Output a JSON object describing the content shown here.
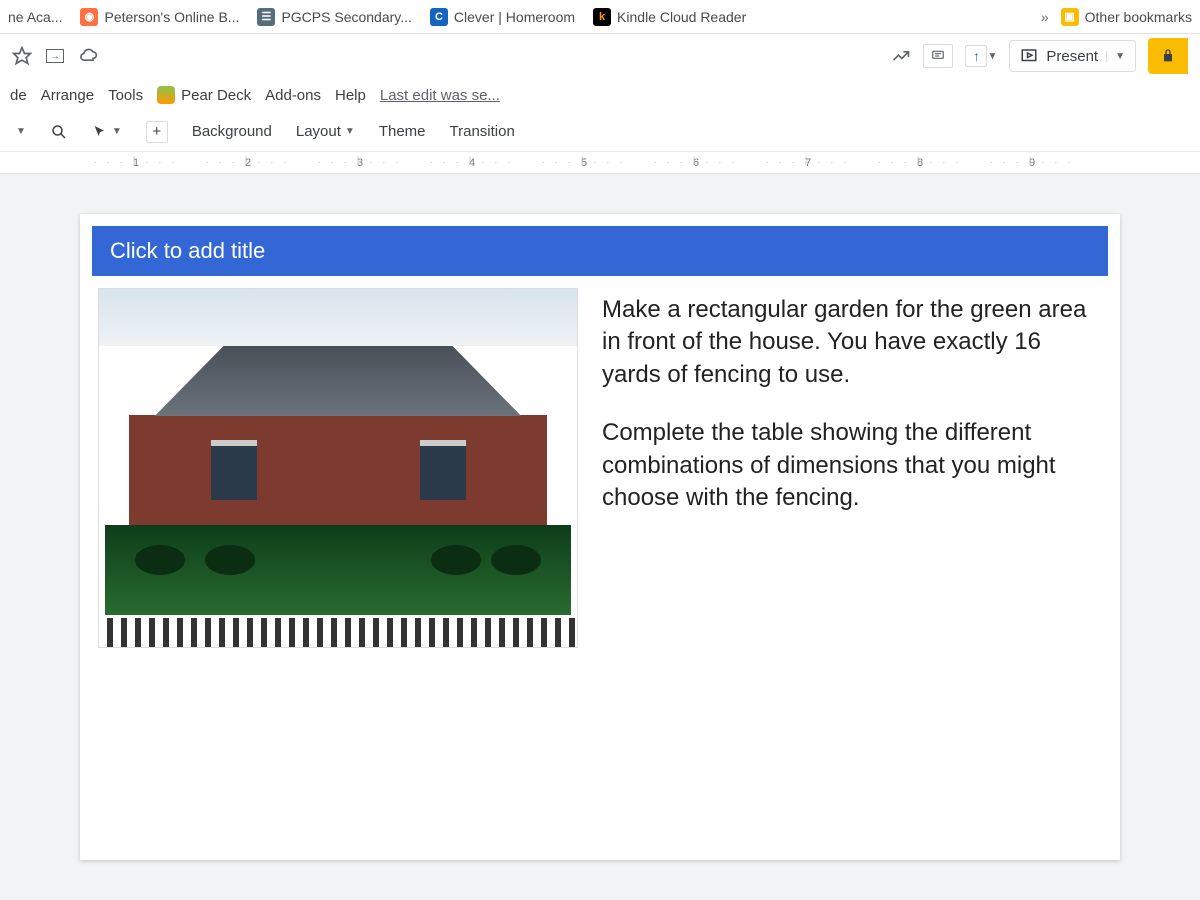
{
  "bookmarks": {
    "items": [
      {
        "label": "ne Aca...",
        "favicon_bg": "#eee",
        "favicon_fg": "#999",
        "glyph": ""
      },
      {
        "label": "Peterson's Online B...",
        "favicon_bg": "#ff7043",
        "favicon_fg": "#fff",
        "glyph": "◉"
      },
      {
        "label": "PGCPS Secondary...",
        "favicon_bg": "#546e7a",
        "favicon_fg": "#fff",
        "glyph": "☰"
      },
      {
        "label": "Clever | Homeroom",
        "favicon_bg": "#1565c0",
        "favicon_fg": "#fff",
        "glyph": "C"
      },
      {
        "label": "Kindle Cloud Reader",
        "favicon_bg": "#000",
        "favicon_fg": "#ff9800",
        "glyph": "k"
      }
    ],
    "overflow": "»",
    "other_label": "Other bookmarks"
  },
  "doc_actions": {
    "present_label": "Present"
  },
  "menu": {
    "items": [
      "de",
      "Arrange",
      "Tools"
    ],
    "addon_pear": "Pear Deck",
    "addons": "Add-ons",
    "help": "Help",
    "last_edit": "Last edit was se..."
  },
  "toolbar": {
    "background": "Background",
    "layout": "Layout",
    "theme": "Theme",
    "transition": "Transition"
  },
  "ruler": [
    "1",
    "2",
    "3",
    "4",
    "5",
    "6",
    "7",
    "8",
    "9"
  ],
  "slide": {
    "title_placeholder": "Click to add title",
    "para1": "Make a rectangular garden for the green area in front of the house. You have exactly 16 yards of fencing to use.",
    "para2": "Complete the table showing the different combinations of dimensions that you might choose with the fencing."
  }
}
